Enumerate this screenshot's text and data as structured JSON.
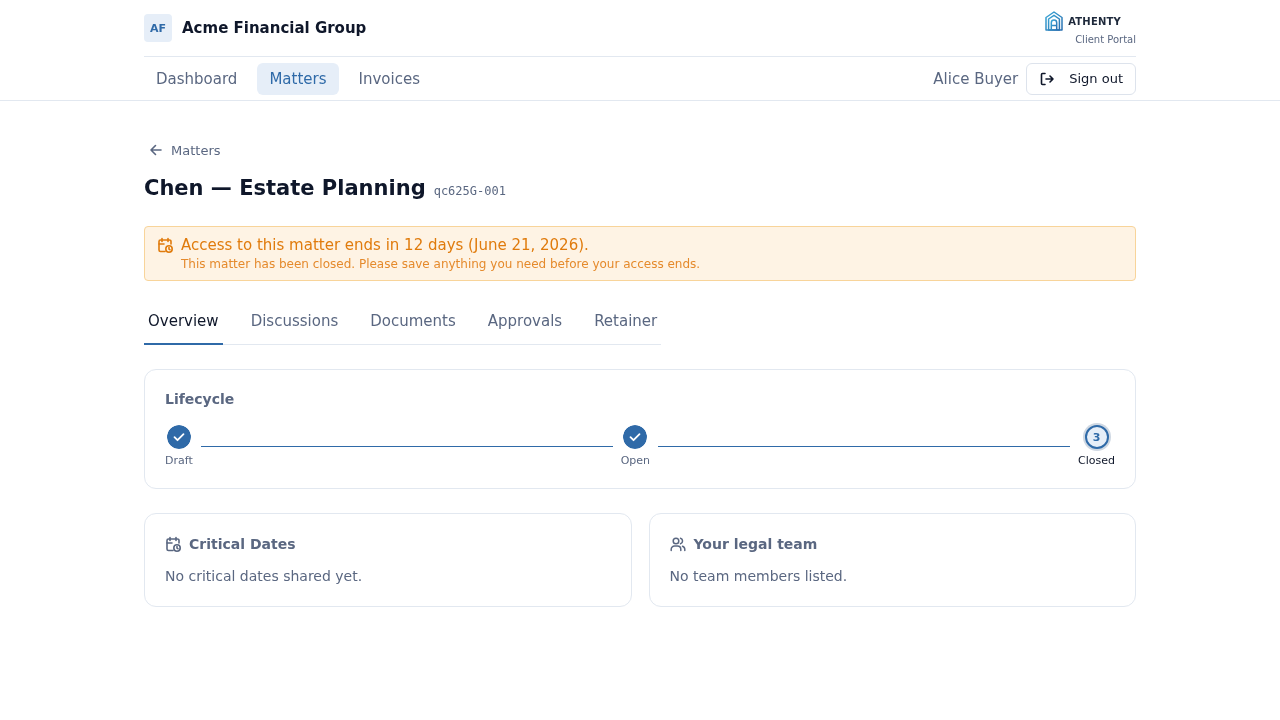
{
  "org": {
    "initials": "AF",
    "name": "Acme Financial Group"
  },
  "brand": {
    "name": "ATHENTY",
    "subtitle": "Client Portal"
  },
  "nav": [
    {
      "label": "Dashboard",
      "selected": false
    },
    {
      "label": "Matters",
      "selected": true
    },
    {
      "label": "Invoices",
      "selected": false
    }
  ],
  "user": {
    "name": "Alice Buyer",
    "sign_out": "Sign out"
  },
  "breadcrumb": {
    "label": "Matters"
  },
  "matter": {
    "title": "Chen — Estate Planning",
    "code": "qc625G-001"
  },
  "notice": {
    "title": "Access to this matter ends in 12 days (June 21, 2026).",
    "message": "This matter has been closed. Please save anything you need before your access ends."
  },
  "tabs": [
    {
      "label": "Overview",
      "selected": true
    },
    {
      "label": "Discussions",
      "selected": false
    },
    {
      "label": "Documents",
      "selected": false
    },
    {
      "label": "Approvals",
      "selected": false
    },
    {
      "label": "Retainer",
      "selected": false
    }
  ],
  "lifecycle": {
    "title": "Lifecycle",
    "steps": [
      {
        "label": "Draft",
        "completed": true,
        "current": false
      },
      {
        "label": "Open",
        "completed": true,
        "current": false
      },
      {
        "label": "Closed",
        "completed": false,
        "current": true,
        "number": "3"
      }
    ]
  },
  "cards": [
    {
      "kind": "dates",
      "title": "Critical Dates",
      "empty": "No critical dates shared yet."
    },
    {
      "kind": "team",
      "title": "Your legal team",
      "empty": "No team members listed."
    }
  ]
}
